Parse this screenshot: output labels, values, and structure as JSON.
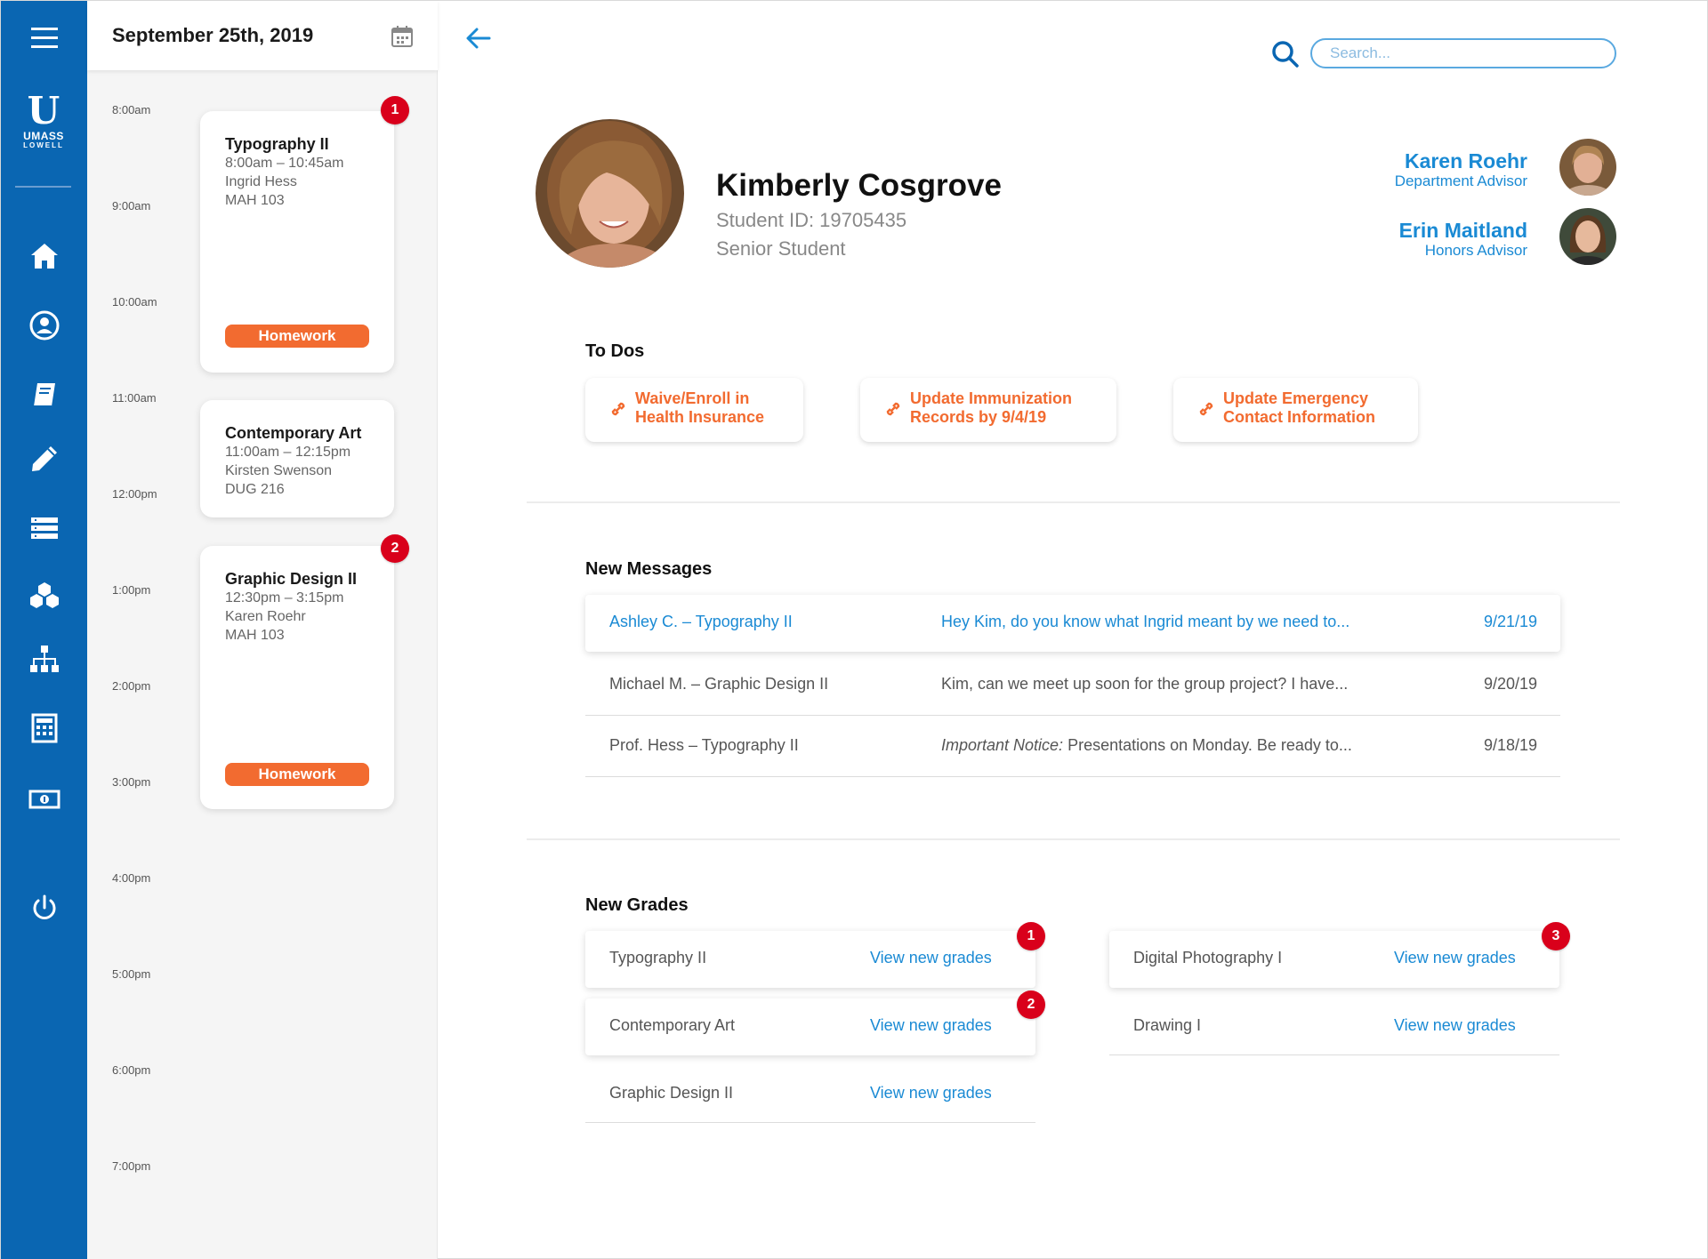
{
  "sidebar": {
    "logo": {
      "mark": "U",
      "line1": "UMASS",
      "line2": "LOWELL"
    },
    "items": [
      {
        "name": "home",
        "icon": "home-icon"
      },
      {
        "name": "profile",
        "icon": "user-circle-icon"
      },
      {
        "name": "courses",
        "icon": "book-icon"
      },
      {
        "name": "assignments",
        "icon": "pencil-icon"
      },
      {
        "name": "records",
        "icon": "list-icon"
      },
      {
        "name": "resources",
        "icon": "boxes-icon"
      },
      {
        "name": "organization",
        "icon": "org-chart-icon"
      },
      {
        "name": "calculator",
        "icon": "calculator-icon"
      },
      {
        "name": "finances",
        "icon": "money-icon"
      },
      {
        "name": "logout",
        "icon": "power-icon"
      }
    ]
  },
  "schedule": {
    "date": "September 25th, 2019",
    "times": [
      "8:00am",
      "9:00am",
      "10:00am",
      "11:00am",
      "12:00pm",
      "1:00pm",
      "2:00pm",
      "3:00pm",
      "4:00pm",
      "5:00pm",
      "6:00pm",
      "7:00pm"
    ],
    "events": [
      {
        "name": "Typography II",
        "time": "8:00am – 10:45am",
        "instructor": "Ingrid Hess",
        "room": "MAH 103",
        "tag": "Homework",
        "badge": "1"
      },
      {
        "name": "Contemporary Art",
        "time": "11:00am – 12:15pm",
        "instructor": "Kirsten Swenson",
        "room": "DUG 216"
      },
      {
        "name": "Graphic Design II",
        "time": "12:30pm – 3:15pm",
        "instructor": "Karen Roehr",
        "room": "MAH 103",
        "tag": "Homework",
        "badge": "2"
      }
    ]
  },
  "header": {
    "search_placeholder": "Search..."
  },
  "student": {
    "name": "Kimberly Cosgrove",
    "id": "Student ID: 19705435",
    "level": "Senior Student"
  },
  "advisors": [
    {
      "name": "Karen Roehr",
      "role": "Department Advisor"
    },
    {
      "name": "Erin Maitland",
      "role": "Honors Advisor"
    }
  ],
  "todos": {
    "title": "To Dos",
    "items": [
      {
        "line1": "Waive/Enroll in",
        "line2": "Health Insurance"
      },
      {
        "line1": "Update Immunization",
        "line2": "Records by 9/4/19"
      },
      {
        "line1": "Update Emergency",
        "line2": "Contact Information"
      }
    ]
  },
  "messages": {
    "title": "New Messages",
    "items": [
      {
        "from": "Ashley C. – Typography II",
        "preview": "Hey Kim, do you know what Ingrid meant by we need to...",
        "date": "9/21/19"
      },
      {
        "from": "Michael M. – Graphic Design II",
        "preview": "Kim, can we meet up soon for the group project? I have...",
        "date": "9/20/19"
      },
      {
        "from": "Prof. Hess – Typography II",
        "preview_em": "Important Notice:",
        "preview": "Presentations on Monday. Be ready to...",
        "date": "9/18/19"
      }
    ]
  },
  "grades": {
    "title": "New Grades",
    "link_label": "View new grades",
    "items": [
      {
        "course": "Typography II",
        "badge": "1"
      },
      {
        "course": "Contemporary Art",
        "badge": "2"
      },
      {
        "course": "Graphic Design II"
      },
      {
        "course": "Digital Photography I",
        "badge": "3"
      },
      {
        "course": "Drawing I"
      }
    ]
  },
  "colors": {
    "primary": "#0a66b2",
    "accent": "#f26b30",
    "link": "#1a8ad4",
    "badge": "#d9001b"
  }
}
